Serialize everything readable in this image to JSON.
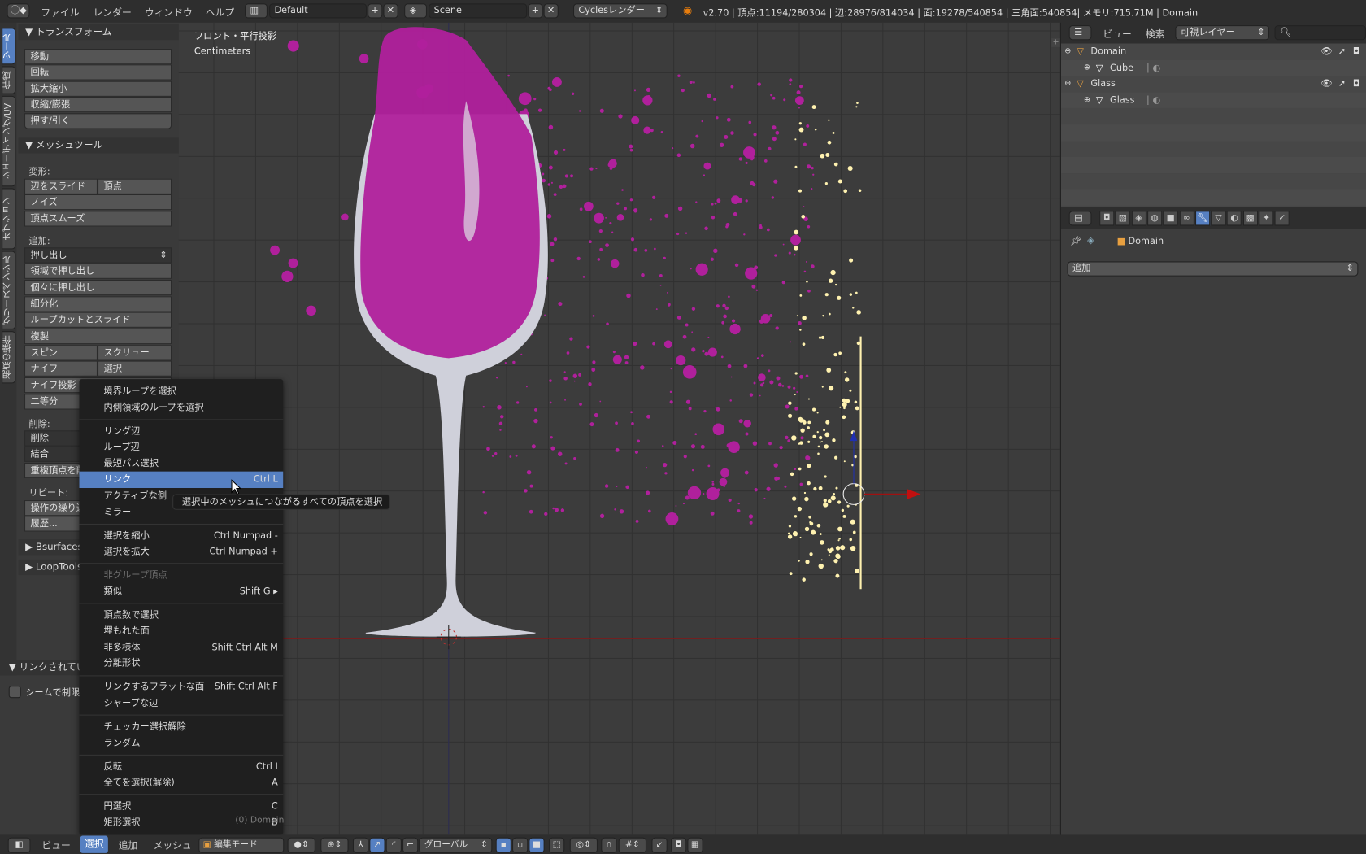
{
  "top_bar": {
    "info_icon": "info-icon",
    "menus": [
      "ファイル",
      "レンダー",
      "ウィンドウ",
      "ヘルプ"
    ],
    "layout": "Default",
    "scene": "Scene",
    "render_engine": "Cyclesレンダー",
    "stats": "v2.70 | 頂点:11194/280304 | 辺:28976/814034 | 面:19278/540854 | 三角面:540854| メモリ:715.71M | Domain"
  },
  "viewport": {
    "view_name": "フロント・平行投影",
    "units": "Centimeters",
    "object_label": "(0) Domain",
    "colors": {
      "liquid": "#b0209c",
      "glass": "#d8d8e0",
      "particles": "#fff2b0",
      "x_axis": "#a01010"
    }
  },
  "tabs": [
    {
      "label": "ツール",
      "active": true
    },
    {
      "label": "作成"
    },
    {
      "label": "シェーディング/UV"
    },
    {
      "label": "オプション"
    },
    {
      "label": "グリースペンシル"
    },
    {
      "label": "視点の操作"
    }
  ],
  "tool_panel": {
    "transform": {
      "title": "トランスフォーム",
      "buttons": [
        "移動",
        "回転",
        "拡大縮小",
        "収縮/膨張",
        "押す/引く"
      ]
    },
    "mesh_tools": {
      "title": "メッシュツール",
      "deform_label": "変形:",
      "slide_edge": "辺をスライド",
      "vertex": "頂点",
      "noise": "ノイズ",
      "smooth_vertex": "頂点スムーズ",
      "add_label": "追加:",
      "extrude": "押し出し",
      "extrude_region": "領域で押し出し",
      "extrude_individual": "個々に押し出し",
      "subdivide": "細分化",
      "loopcut": "ループカットとスライド",
      "duplicate": "複製",
      "spin": "スピン",
      "screw": "スクリュー",
      "knife": "ナイフ",
      "select": "選択",
      "knife_project": "ナイフ投影",
      "bisect": "二等分",
      "delete_label": "削除:",
      "delete": "削除",
      "merge": "結合",
      "remove_doubles": "重複頂点を削除",
      "repeat_label": "リピート:",
      "repeat_last": "操作の繰り返し",
      "history": "履歴..."
    },
    "bsurfaces": "Bsurfaces",
    "looptools": "LoopTools",
    "operator_panel": {
      "title": "リンクされている物を選択",
      "delimit_seam": "シームで制限",
      "delimit_checked": false
    }
  },
  "select_menu": {
    "groups": [
      [
        {
          "label": "境界ループを選択"
        },
        {
          "label": "内側領域のループを選択"
        }
      ],
      [
        {
          "label": "リング辺"
        },
        {
          "label": "ループ辺"
        },
        {
          "label": "最短パス選択"
        },
        {
          "label": "リンク",
          "shortcut": "Ctrl L",
          "highlighted": true
        },
        {
          "label": "アクティブな側"
        },
        {
          "label": "ミラー"
        }
      ],
      [
        {
          "label": "選択を縮小",
          "shortcut": "Ctrl Numpad -"
        },
        {
          "label": "選択を拡大",
          "shortcut": "Ctrl Numpad +"
        }
      ],
      [
        {
          "label": "非グループ頂点",
          "disabled": true
        },
        {
          "label": "類似",
          "shortcut": "Shift G ▸"
        }
      ],
      [
        {
          "label": "頂点数で選択"
        },
        {
          "label": "埋もれた面"
        },
        {
          "label": "非多様体",
          "shortcut": "Shift Ctrl Alt M"
        },
        {
          "label": "分離形状"
        }
      ],
      [
        {
          "label": "リンクするフラットな面",
          "shortcut": "Shift Ctrl Alt F"
        },
        {
          "label": "シャープな辺"
        }
      ],
      [
        {
          "label": "チェッカー選択解除"
        },
        {
          "label": "ランダム"
        }
      ],
      [
        {
          "label": "反転",
          "shortcut": "Ctrl I"
        },
        {
          "label": "全てを選択(解除)",
          "shortcut": "A"
        }
      ],
      [
        {
          "label": "円選択",
          "shortcut": "C"
        },
        {
          "label": "矩形選択",
          "shortcut": "B"
        }
      ]
    ],
    "tooltip": "選択中のメッシュにつながるすべての頂点を選択"
  },
  "outliner": {
    "view": "ビュー",
    "search": "検索",
    "filter": "可視レイヤー",
    "items": [
      {
        "name": "Domain",
        "level": 0,
        "type": "object"
      },
      {
        "name": "Cube",
        "level": 1,
        "type": "mesh"
      },
      {
        "name": "Glass",
        "level": 0,
        "type": "object"
      },
      {
        "name": "Glass",
        "level": 1,
        "type": "mesh"
      }
    ]
  },
  "properties": {
    "tabs": [
      "render",
      "render-layers",
      "scene",
      "world",
      "object",
      "constraints",
      "modifiers",
      "data",
      "material",
      "texture",
      "particles",
      "physics"
    ],
    "active_tab": "modifiers",
    "breadcrumb": "Domain",
    "add_modifier": "追加"
  },
  "bottom_bar": {
    "menus": [
      "ビュー",
      "選択",
      "追加",
      "メッシュ"
    ],
    "active_menu": "選択",
    "mode": "編集モード",
    "orientation": "グローバル"
  }
}
